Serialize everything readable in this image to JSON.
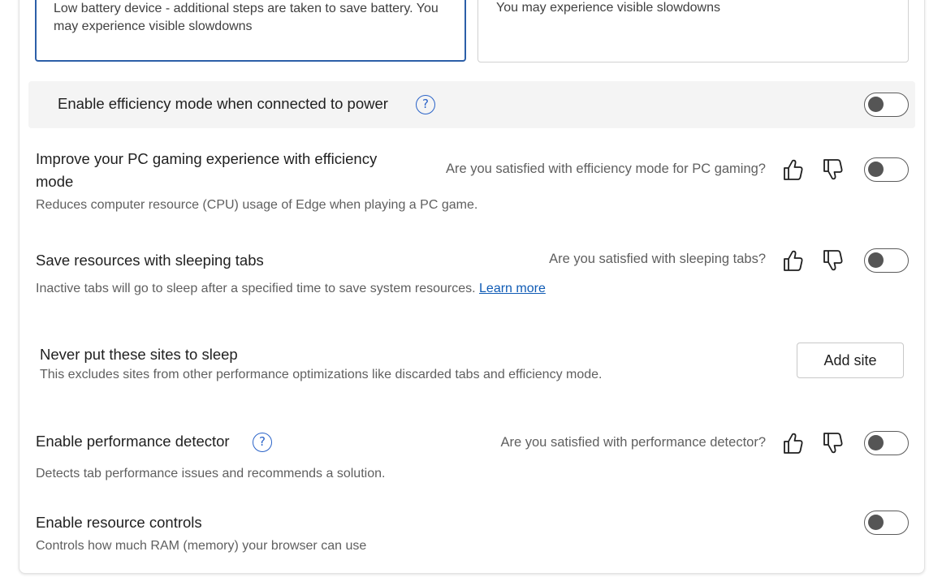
{
  "options": {
    "low_battery_text": "Low battery device - additional steps are taken to save battery. You may experience visible slowdowns",
    "other_text": "You may experience visible slowdowns"
  },
  "efficiency_power": {
    "title": "Enable efficiency mode when connected to power",
    "enabled": false
  },
  "gaming": {
    "title": "Improve your PC gaming experience with efficiency mode",
    "description": "Reduces computer resource (CPU) usage of Edge when playing a PC game.",
    "question": "Are you satisfied with efficiency mode for PC gaming?",
    "enabled": false
  },
  "sleeping_tabs": {
    "title": "Save resources with sleeping tabs",
    "description": "Inactive tabs will go to sleep after a specified time to save system resources.",
    "learn_more": "Learn more",
    "question": "Are you satisfied with sleeping tabs?",
    "enabled": false
  },
  "never_sleep": {
    "title": "Never put these sites to sleep",
    "description": "This excludes sites from other performance optimizations like discarded tabs and efficiency mode.",
    "button_label": "Add site"
  },
  "performance_detector": {
    "title": "Enable performance detector",
    "description": "Detects tab performance issues and recommends a solution.",
    "question": "Are you satisfied with performance detector?",
    "enabled": false
  },
  "resource_controls": {
    "title": "Enable resource controls",
    "description": "Controls how much RAM (memory) your browser can use",
    "enabled": false
  },
  "icons": {
    "help": "?",
    "thumbs_up": "thumbs-up-icon",
    "thumbs_down": "thumbs-down-icon"
  },
  "colors": {
    "accent": "#2c5fa8",
    "link": "#0f5bb5",
    "toggle_off_knob": "#555555"
  }
}
